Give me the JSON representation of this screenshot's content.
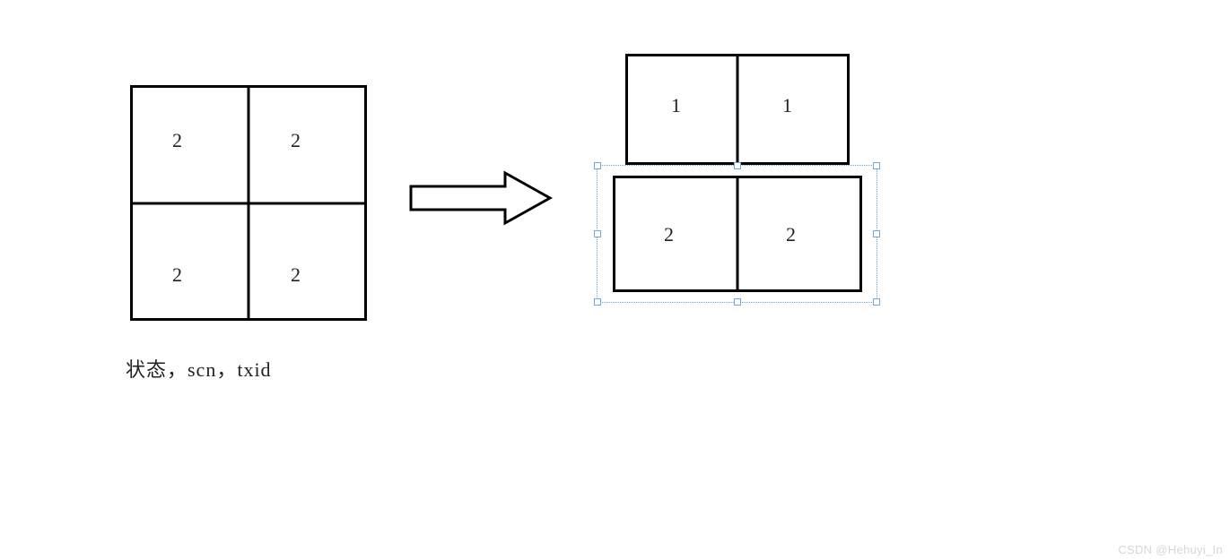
{
  "left_grid": {
    "cells": {
      "tl": "2",
      "tr": "2",
      "bl": "2",
      "br": "2"
    }
  },
  "right_grid": {
    "top_cells": {
      "tl": "1",
      "tr": "1"
    },
    "bottom_cells": {
      "bl": "2",
      "br": "2"
    }
  },
  "caption": "状态，scn，txid",
  "watermark": "CSDN @Hehuyi_In",
  "chart_data": {
    "type": "table",
    "title": "",
    "description": "State transition diagram: left 2x2 grid transforms into right 2x2 grid (top row boxed solid, bottom row slightly wider with selection outline)",
    "left": [
      [
        2,
        2
      ],
      [
        2,
        2
      ]
    ],
    "right": [
      [
        1,
        1
      ],
      [
        2,
        2
      ]
    ],
    "caption": "状态，scn，txid"
  }
}
